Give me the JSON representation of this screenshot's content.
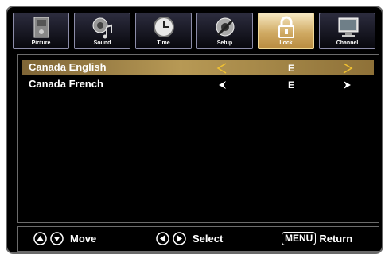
{
  "tabs": [
    {
      "label": "Picture",
      "icon": "picture-icon"
    },
    {
      "label": "Sound",
      "icon": "sound-icon"
    },
    {
      "label": "Time",
      "icon": "clock-icon"
    },
    {
      "label": "Setup",
      "icon": "setup-icon"
    },
    {
      "label": "Lock",
      "icon": "lock-icon",
      "active": true
    },
    {
      "label": "Channel",
      "icon": "channel-icon"
    }
  ],
  "rows": [
    {
      "name": "Canada English",
      "value": "E",
      "selected": true
    },
    {
      "name": "Canada French",
      "value": "E",
      "selected": false
    }
  ],
  "footer": {
    "move_label": "Move",
    "select_label": "Select",
    "menu_key": "MENU",
    "return_label": "Return"
  },
  "colors": {
    "active_tab": "#d0aa63",
    "selected_row": "#b79955",
    "selected_arrow": "#f1c232"
  }
}
